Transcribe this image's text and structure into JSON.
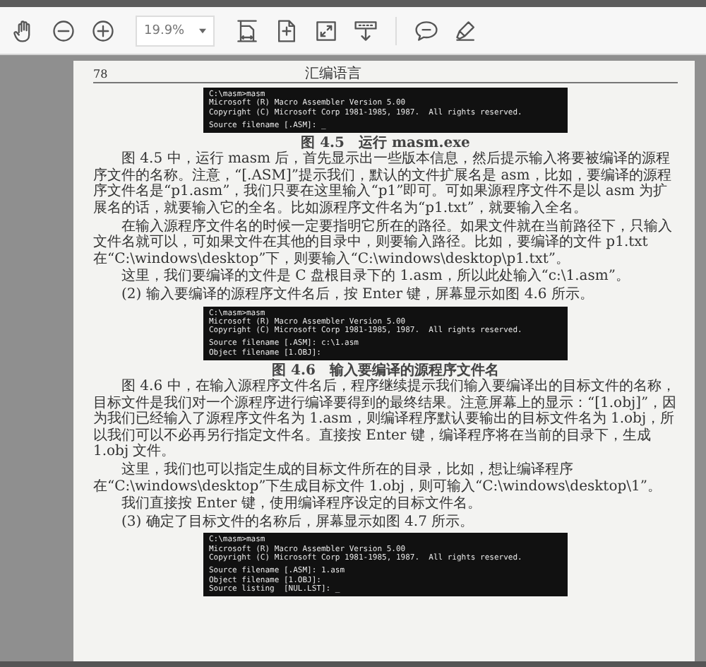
{
  "toolbar": {
    "zoom": "19.9%"
  },
  "page": {
    "number": "78",
    "running_title": "汇编语言",
    "blocks": [
      {
        "kind": "terminal",
        "groups": [
          [
            "C:\\masm>masm",
            "Microsoft (R) Macro Assembler Version 5.00",
            "Copyright (C) Microsoft Corp 1981-1985, 1987.  All rights reserved."
          ],
          [
            "Source filename [.ASM]: _"
          ]
        ]
      },
      {
        "kind": "caption",
        "text": "图 4.5　运行 masm.exe"
      },
      {
        "kind": "paragraph",
        "text": "图 4.5 中，运行 masm 后，首先显示出一些版本信息，然后提示输入将要被编译的源程序文件的名称。注意，“[.ASM]”提示我们，默认的文件扩展名是 asm，比如，要编译的源程序文件名是“p1.asm”，我们只要在这里输入“p1”即可。可如果源程序文件不是以 asm 为扩展名的话，就要输入它的全名。比如源程序文件名为“p1.txt”，就要输入全名。"
      },
      {
        "kind": "paragraph",
        "text": "在输入源程序文件名的时候一定要指明它所在的路径。如果文件就在当前路径下，只输入文件名就可以，可如果文件在其他的目录中，则要输入路径。比如，要编译的文件 p1.txt 在“C:\\windows\\desktop”下，则要输入“C:\\windows\\desktop\\p1.txt”。"
      },
      {
        "kind": "paragraph",
        "text": "这里，我们要编译的文件是 C 盘根目录下的 1.asm，所以此处输入“c:\\1.asm”。"
      },
      {
        "kind": "paragraph",
        "text": "(2)  输入要编译的源程序文件名后，按 Enter 键，屏幕显示如图 4.6 所示。"
      },
      {
        "kind": "terminal",
        "groups": [
          [
            "C:\\masm>masm",
            "Microsoft (R) Macro Assembler Version 5.00",
            "Copyright (C) Microsoft Corp 1981-1985, 1987.  All rights reserved."
          ],
          [
            "Source filename [.ASM]: c:\\1.asm",
            "Object filename [1.OBJ]:"
          ]
        ]
      },
      {
        "kind": "caption",
        "text": "图 4.6　输入要编译的源程序文件名"
      },
      {
        "kind": "paragraph",
        "text": "图 4.6 中，在输入源程序文件名后，程序继续提示我们输入要编译出的目标文件的名称，目标文件是我们对一个源程序进行编译要得到的最终结果。注意屏幕上的显示：“[1.obj]”，因为我们已经输入了源程序文件名为 1.asm，则编译程序默认要输出的目标文件名为 1.obj，所以我们可以不必再另行指定文件名。直接按 Enter 键，编译程序将在当前的目录下，生成 1.obj 文件。"
      },
      {
        "kind": "paragraph",
        "text": "这里，我们也可以指定生成的目标文件所在的目录，比如，想让编译程序在“C:\\windows\\desktop”下生成目标文件 1.obj，则可输入“C:\\windows\\desktop\\1”。"
      },
      {
        "kind": "paragraph",
        "text": "我们直接按 Enter 键，使用编译程序设定的目标文件名。"
      },
      {
        "kind": "paragraph",
        "text": "(3)  确定了目标文件的名称后，屏幕显示如图 4.7 所示。"
      },
      {
        "kind": "terminal",
        "groups": [
          [
            "C:\\masm>masm",
            "Microsoft (R) Macro Assembler Version 5.00",
            "Copyright (C) Microsoft Corp 1981-1985, 1987.  All rights reserved."
          ],
          [
            "Source filename [.ASM]: 1.asm",
            "Object filename [1.OBJ]:",
            "Source listing  [NUL.LST]: _"
          ]
        ]
      }
    ]
  }
}
